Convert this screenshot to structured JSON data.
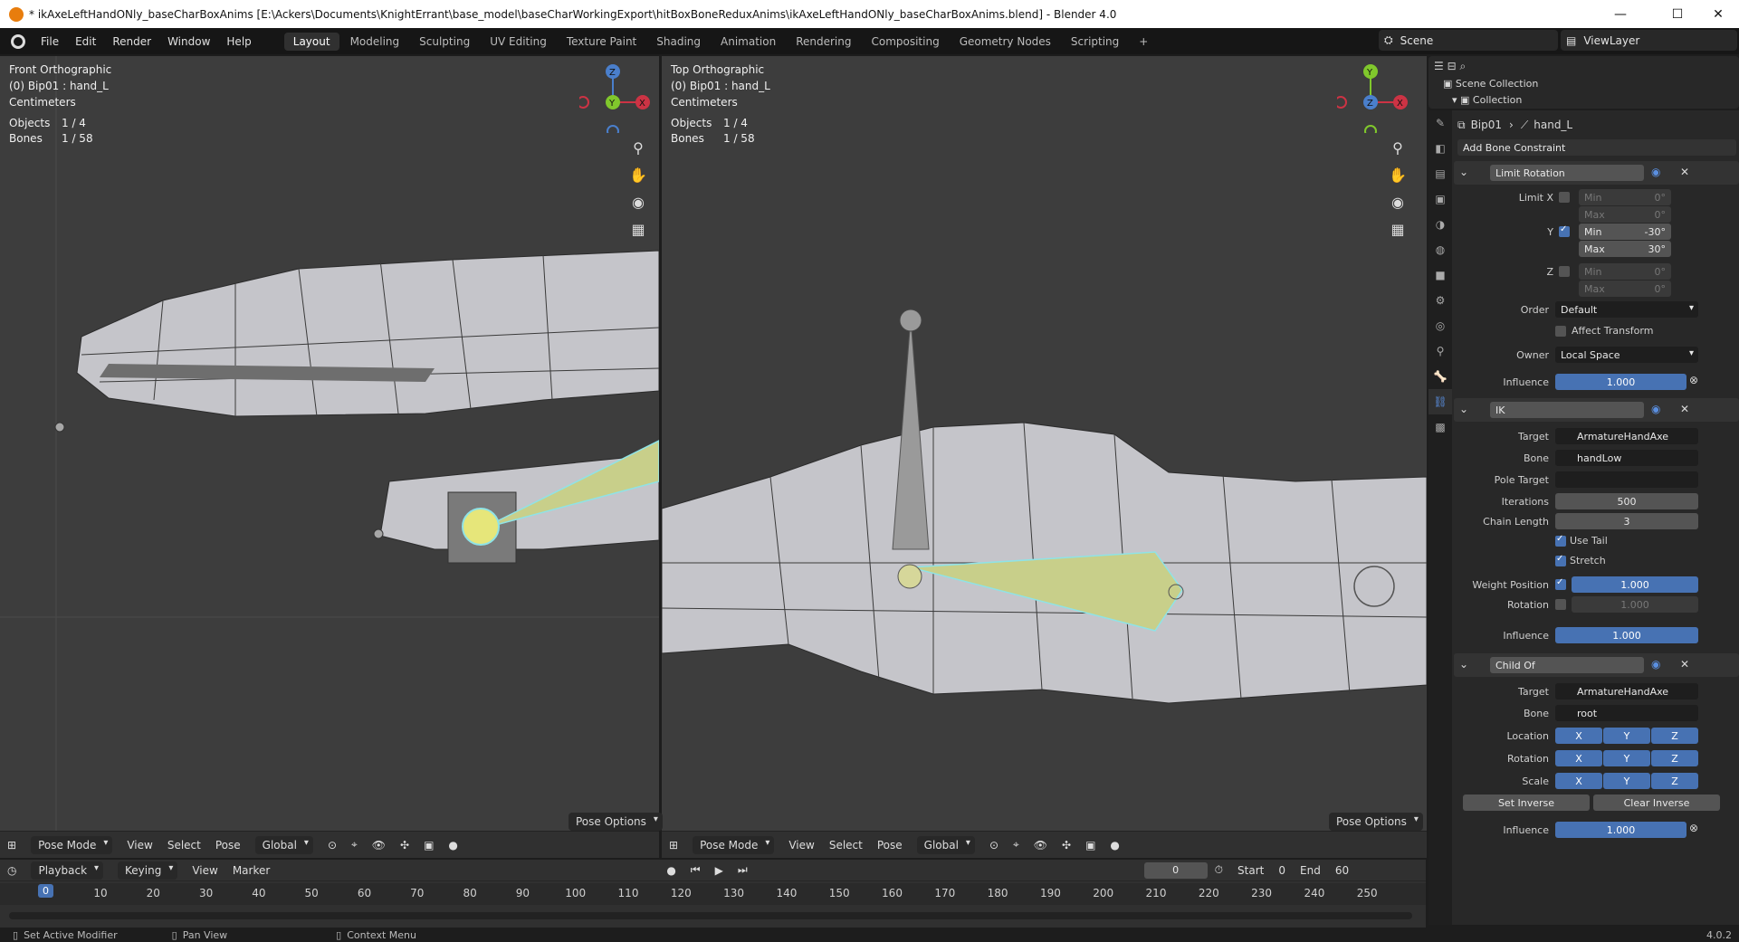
{
  "window": {
    "title": "* ikAxeLeftHandONly_baseCharBoxAnims [E:\\Ackers\\Documents\\KnightErrant\\base_model\\baseCharWorkingExport\\hitBoxBoneReduxAnims\\ikAxeLeftHandONly_baseCharBoxAnims.blend] - Blender 4.0",
    "min": "—",
    "max": "☐",
    "close": "✕"
  },
  "menu": [
    "File",
    "Edit",
    "Render",
    "Window",
    "Help"
  ],
  "workspaces": [
    "Layout",
    "Modeling",
    "Sculpting",
    "UV Editing",
    "Texture Paint",
    "Shading",
    "Animation",
    "Rendering",
    "Compositing",
    "Geometry Nodes",
    "Scripting"
  ],
  "workspace_add": "+",
  "scene": "Scene",
  "view_layer": "ViewLayer",
  "vp_left": {
    "view": "Front Orthographic",
    "obj": "(0) Bip01 : hand_L",
    "units": "Centimeters",
    "objects_label": "Objects",
    "objects_val": "1 / 4",
    "bones_label": "Bones",
    "bones_val": "1 / 58"
  },
  "vp_right": {
    "view": "Top Orthographic",
    "obj": "(0) Bip01 : hand_L",
    "units": "Centimeters",
    "objects_label": "Objects",
    "objects_val": "1 / 4",
    "bones_label": "Bones",
    "bones_val": "1 / 58"
  },
  "axis": {
    "x": "X",
    "y": "Y",
    "z": "Z"
  },
  "vp_header": {
    "mode": "Pose Mode",
    "view": "View",
    "select": "Select",
    "pose": "Pose",
    "orient": "Global",
    "pose_options": "Pose Options"
  },
  "timeline": {
    "playback": "Playback",
    "keying": "Keying",
    "view": "View",
    "marker": "Marker",
    "current": "0",
    "start_label": "Start",
    "start": "0",
    "end_label": "End",
    "end": "60",
    "cur_frame": "0",
    "ticks": [
      "10",
      "20",
      "30",
      "40",
      "50",
      "60",
      "70",
      "80",
      "90",
      "100",
      "110",
      "120",
      "130",
      "140",
      "150",
      "160",
      "170",
      "180",
      "190",
      "200",
      "210",
      "220",
      "230",
      "240",
      "250"
    ]
  },
  "status": {
    "left": "Set Active Modifier",
    "mid": "Pan View",
    "right": "Context Menu",
    "version": "4.0.2"
  },
  "outliner": {
    "scene_collection": "Scene Collection",
    "collection": "Collection"
  },
  "props": {
    "breadcrumb_obj": "Bip01",
    "breadcrumb_bone": "hand_L",
    "add": "Add Bone Constraint",
    "limit_rot": {
      "name": "Limit Rotation",
      "limit_x": "Limit X",
      "y": "Y",
      "z": "Z",
      "min": "Min",
      "max": "Max",
      "x_min": "0°",
      "x_max": "0°",
      "y_min": "-30°",
      "y_max": "30°",
      "z_min": "0°",
      "z_max": "0°",
      "order_label": "Order",
      "order": "Default",
      "affect": "Affect Transform",
      "owner_label": "Owner",
      "owner": "Local Space",
      "infl_label": "Influence",
      "infl": "1.000"
    },
    "ik": {
      "name": "IK",
      "target_label": "Target",
      "target": "ArmatureHandAxe",
      "bone_label": "Bone",
      "bone": "handLow",
      "pole_label": "Pole Target",
      "iter_label": "Iterations",
      "iter": "500",
      "chain_label": "Chain Length",
      "chain": "3",
      "use_tail": "Use Tail",
      "stretch": "Stretch",
      "wp_label": "Weight Position",
      "wp": "1.000",
      "rot_label": "Rotation",
      "rot": "1.000",
      "infl_label": "Influence",
      "infl": "1.000"
    },
    "child": {
      "name": "Child Of",
      "target_label": "Target",
      "target": "ArmatureHandAxe",
      "bone_label": "Bone",
      "bone": "root",
      "loc_label": "Location",
      "rot_label": "Rotation",
      "scale_label": "Scale",
      "x": "X",
      "y": "Y",
      "z": "Z",
      "set_inv": "Set Inverse",
      "clear_inv": "Clear Inverse",
      "infl_label": "Influence",
      "infl": "1.000"
    }
  }
}
